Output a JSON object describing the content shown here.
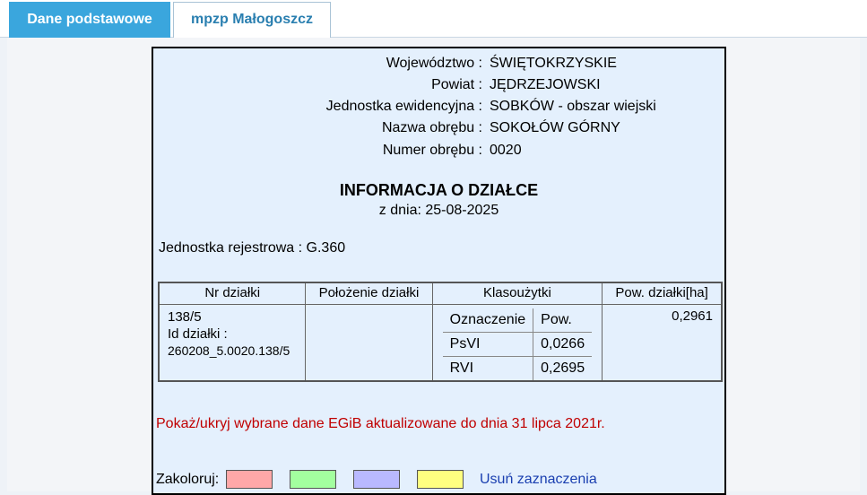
{
  "tabs": [
    {
      "label": "Dane podstawowe",
      "active": true
    },
    {
      "label": "mpzp Małogoszcz",
      "active": false
    }
  ],
  "location": {
    "wojewodztwo_label": "Województwo :",
    "wojewodztwo_value": "ŚWIĘTOKRZYSKIE",
    "powiat_label": "Powiat :",
    "powiat_value": "JĘDRZEJOWSKI",
    "jednostka_label": "Jednostka ewidencyjna :",
    "jednostka_value": "SOBKÓW - obszar wiejski",
    "obreb_nazwa_label": "Nazwa obrębu :",
    "obreb_nazwa_value": "SOKOŁÓW GÓRNY",
    "obreb_numer_label": "Numer obrębu :",
    "obreb_numer_value": "0020"
  },
  "header": {
    "title": "INFORMACJA O DZIAŁCE",
    "date": "z dnia: 25-08-2025"
  },
  "jednostka_rejestrowa": "Jednostka rejestrowa : G.360",
  "table": {
    "columns": [
      "Nr działki",
      "Położenie działki",
      "Klasoużytki",
      "Pow. działki[ha]"
    ],
    "nr": "138/5",
    "id_label": "Id działki :",
    "id_value": "260208_5.0020.138/5",
    "polozenie": "",
    "klasouzytki_header": [
      "Oznaczenie",
      "Pow."
    ],
    "klasouzytki": [
      {
        "oznaczenie": "PsVI",
        "pow": "0,0266"
      },
      {
        "oznaczenie": "RVI",
        "pow": "0,2695"
      }
    ],
    "pow_dzialki": "0,2961"
  },
  "toggle_link": "Pokaż/ukryj wybrane dane EGiB aktualizowane do dnia 31 lipca 2021r.",
  "coloring": {
    "label": "Zakoloruj:",
    "swatches": [
      "#ffa8a8",
      "#a3ff9f",
      "#b9b9ff",
      "#ffff80"
    ],
    "clear_label": "Usuń zaznaczenia"
  }
}
